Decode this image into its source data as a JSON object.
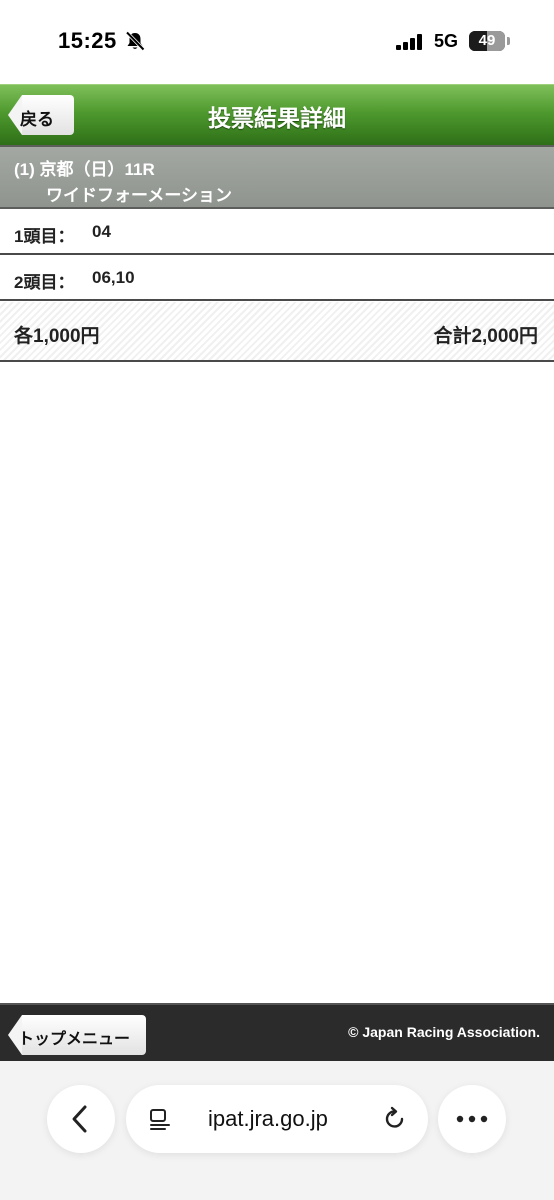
{
  "status_bar": {
    "time": "15:25",
    "network": "5G",
    "battery": "49",
    "icons": [
      "bell-slash-icon",
      "signal-bars-icon",
      "battery-icon"
    ]
  },
  "header": {
    "back_label": "戻る",
    "title": "投票結果詳細",
    "accent_color": "#4f9a2f"
  },
  "race": {
    "line1": "(1) 京都（日）11R",
    "line2": "ワイドフォーメーション"
  },
  "horses": [
    {
      "label": "1頭目：",
      "value": "04"
    },
    {
      "label": "2頭目：",
      "value": "06,10"
    }
  ],
  "amount": {
    "each": "各1,000円",
    "total": "合計2,000円"
  },
  "footer": {
    "top_menu_label": "トップメニュー",
    "copyright": "© Japan Racing Association."
  },
  "browser": {
    "url": "ipat.jra.go.jp",
    "icons": [
      "chevron-left-icon",
      "reader-icon",
      "reload-icon",
      "more-icon"
    ]
  }
}
